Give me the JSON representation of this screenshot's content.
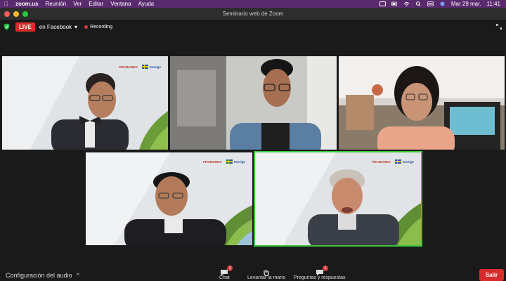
{
  "menubar": {
    "app": "zoom.us",
    "items": [
      "Reunión",
      "Ver",
      "Editar",
      "Ventana",
      "Ayuda"
    ],
    "date": "Mar 29 mar.",
    "time": "11:41"
  },
  "window": {
    "title": "Seminario web de Zoom"
  },
  "topbar": {
    "live_label": "LIVE",
    "stream_target": "en Facebook",
    "recording_label": "Recording"
  },
  "branding": {
    "promundo": "PROMUNDO",
    "sverige_small": "Sverige",
    "sverige_top": "Sweden"
  },
  "toolbar": {
    "audio_settings": "Configuración del audio",
    "chat_label": "Chat",
    "chat_badge": "2",
    "raise_hand_label": "Levantar la mano",
    "qa_label": "Preguntas y respuestas",
    "qa_badge": "1",
    "leave_label": "Salir"
  },
  "colors": {
    "menubar": "#5a2a6e",
    "live": "#d82c2c",
    "active_speaker": "#3cc43c"
  }
}
